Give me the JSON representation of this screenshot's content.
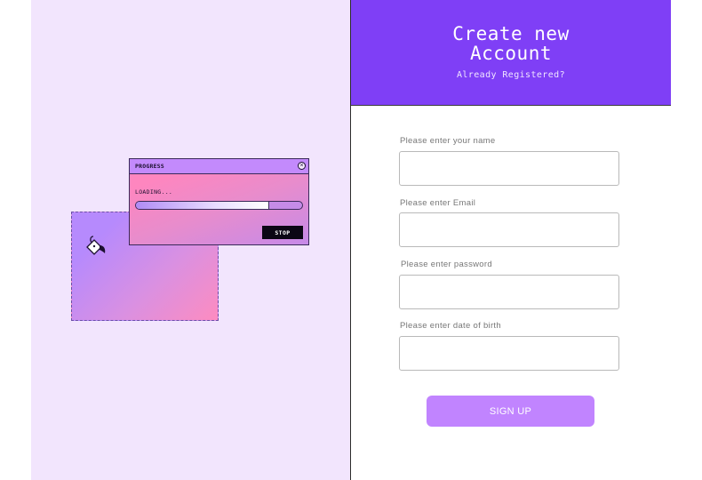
{
  "header": {
    "title_line1": "Create new",
    "title_line2": "Account",
    "subtitle": "Already Registered?"
  },
  "form": {
    "fields": [
      {
        "label": "Please enter your name",
        "value": ""
      },
      {
        "label": "Please enter Email",
        "value": ""
      },
      {
        "label": "Please enter password",
        "value": ""
      },
      {
        "label": "Please enter date of birth",
        "value": ""
      }
    ],
    "submit_label": "SIGN UP"
  },
  "illustration": {
    "window_title": "PROGRESS",
    "loading_text": "LOADING...",
    "progress": 0.8,
    "stop_label": "STOP",
    "close_icon": "close-icon",
    "bucket_icon": "paint-bucket-icon"
  },
  "colors": {
    "accent": "#7f3ff6",
    "left_panel_bg": "#f2e5fd",
    "button": "#c184ff"
  }
}
